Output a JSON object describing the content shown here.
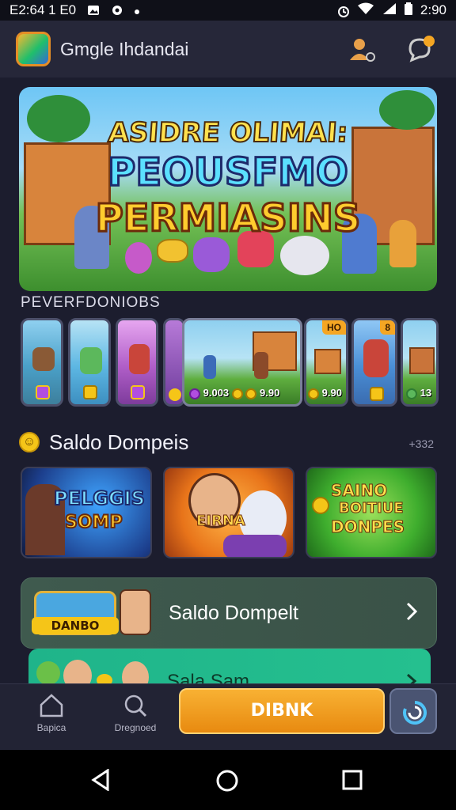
{
  "status_bar": {
    "time_left": "E2:64 1 E0",
    "time_right": "2:90",
    "icons": [
      "image-icon",
      "settings-icon",
      "dot-icon",
      "alarm-icon",
      "wifi-icon",
      "signal-icon",
      "battery-icon"
    ]
  },
  "header": {
    "title": "Gmgle Ihdandai",
    "icons": [
      "user-icon",
      "chat-icon"
    ]
  },
  "hero": {
    "line1": "ASIDRE OLIMAI:",
    "line2": "PEOUSFMO",
    "line3": "PERMIASINS"
  },
  "section1": {
    "title": "PEVERFDONIOBS",
    "cards": [
      {
        "value": ""
      },
      {
        "value": ""
      },
      {
        "value": ""
      },
      {
        "value": ""
      },
      {
        "value": "9.003",
        "value2": "9.90"
      },
      {
        "value": "9.90",
        "tag": "HO"
      },
      {
        "value": "",
        "tag": "8"
      },
      {
        "value": "13"
      }
    ]
  },
  "section2": {
    "icon_char": "☺",
    "title": "Saldo Dompeis",
    "more": "+332",
    "promos": [
      {
        "line1": "PELGGIS",
        "line2": "SOMP"
      },
      {
        "line1": "EIRNA"
      },
      {
        "line1": "SAINO",
        "line2": "BOITIUE",
        "line3": "DONPES"
      }
    ]
  },
  "wallet": {
    "badge": "DANBO",
    "label": "Saldo Dompelt",
    "second_label": "Sala Sam"
  },
  "bottom_nav": {
    "home_label": "Bapica",
    "search_label": "Dregnoed",
    "cta_label": "DIBNK"
  },
  "colors": {
    "background": "#1c1d2e",
    "header": "#262739",
    "accent": "#f5a623",
    "wallet": "#3f5a4e",
    "wallet2": "#1fb48a"
  }
}
